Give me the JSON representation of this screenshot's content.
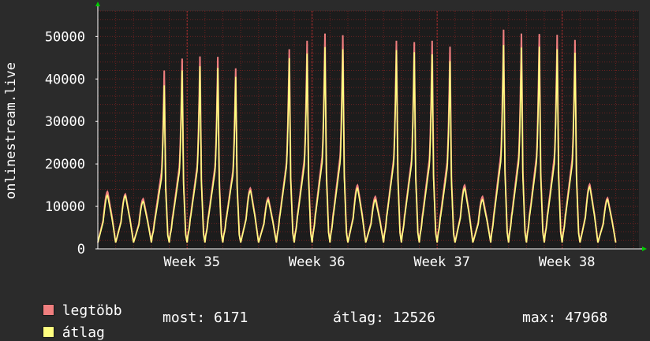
{
  "chart_data": {
    "type": "area",
    "ylabel": "onlinestream.live",
    "ylim": [
      0,
      56000
    ],
    "y_ticks": [
      0,
      10000,
      20000,
      30000,
      40000,
      50000
    ],
    "y_tick_labels": [
      "0",
      "10000",
      "20000",
      "30000",
      "40000",
      "50000"
    ],
    "x_tick_labels": [
      "Week 35",
      "Week 36",
      "Week 37",
      "Week 38"
    ],
    "grid": true,
    "x_axis_unit": "days",
    "x_range_days": [
      0,
      30.3
    ],
    "x_tick_days": [
      5.0,
      12.0,
      19.0,
      26.0
    ],
    "daily_peaks": {
      "day": [
        0,
        1,
        2,
        3,
        4,
        5,
        6,
        7,
        8,
        9,
        10,
        11,
        12,
        13,
        14,
        15,
        16,
        17,
        18,
        19,
        20,
        21,
        22,
        23,
        24,
        25,
        26,
        27,
        28,
        29,
        30
      ],
      "max": [
        13500,
        12900,
        11800,
        42000,
        44800,
        45300,
        45200,
        42500,
        14300,
        12000,
        47000,
        49000,
        50700,
        50300,
        15000,
        12300,
        49000,
        48700,
        49000,
        47600,
        15000,
        12300,
        51600,
        50700,
        50600,
        50400,
        49200,
        15200,
        12000,
        0,
        0
      ],
      "avg": [
        12600,
        12500,
        11200,
        38500,
        42000,
        43000,
        42600,
        40500,
        13700,
        11500,
        44900,
        46000,
        47500,
        47000,
        14300,
        11600,
        46800,
        46300,
        45800,
        44200,
        14300,
        11600,
        48000,
        47400,
        47600,
        47000,
        46200,
        14600,
        11600,
        0,
        0
      ]
    },
    "series": [
      {
        "name": "legtöbb",
        "color": "#f07f7f"
      },
      {
        "name": "átlag",
        "color": "#ffff80"
      }
    ]
  },
  "legend": {
    "items": [
      {
        "label": "legtöbb",
        "color": "#f07f7f"
      },
      {
        "label": "átlag",
        "color": "#ffff80"
      }
    ],
    "now_label": "most:",
    "now_value": "6171",
    "avg_label": "átlag:",
    "avg_value": "12526",
    "max_label": "max:",
    "max_value": "47968"
  }
}
